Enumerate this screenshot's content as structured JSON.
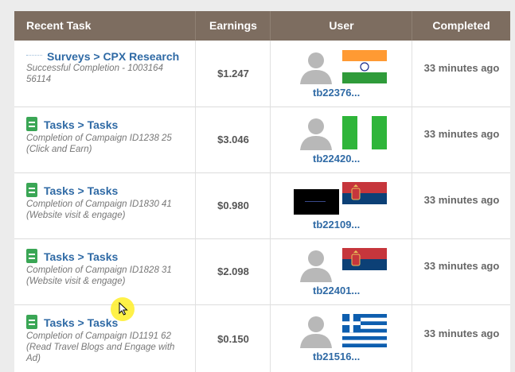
{
  "headers": {
    "recent_task": "Recent Task",
    "earnings": "Earnings",
    "user": "User",
    "completed": "Completed"
  },
  "rows": [
    {
      "task_title": "Surveys > CPX Research",
      "task_sub": "Successful Completion - 1003164 56114",
      "earnings": "$1.247",
      "user": "tb22376...",
      "completed": "33 minutes ago",
      "flag": "india-flag"
    },
    {
      "task_title": "Tasks > Tasks",
      "task_sub": "Completion of Campaign ID1238 25 (Click and Earn)",
      "earnings": "$3.046",
      "user": "tb22420...",
      "completed": "33 minutes ago",
      "flag": "nigeria-flag"
    },
    {
      "task_title": "Tasks > Tasks",
      "task_sub": "Completion of Campaign ID1830 41 (Website visit & engage)",
      "earnings": "$0.980",
      "user": "tb22109...",
      "completed": "33 minutes ago",
      "flag": "serbia-flag"
    },
    {
      "task_title": "Tasks > Tasks",
      "task_sub": "Completion of Campaign ID1828 31 (Website visit & engage)",
      "earnings": "$2.098",
      "user": "tb22401...",
      "completed": "33 minutes ago",
      "flag": "serbia-flag"
    },
    {
      "task_title": "Tasks > Tasks",
      "task_sub": "Completion of Campaign ID1191 62 (Read Travel Blogs and Engage with Ad)",
      "earnings": "$0.150",
      "user": "tb21516...",
      "completed": "33 minutes ago",
      "flag": "greece-flag"
    }
  ],
  "colors": {
    "header_bg": "#7d6d60",
    "link_blue": "#2f6aa5",
    "task_icon_green": "#3aa655"
  }
}
